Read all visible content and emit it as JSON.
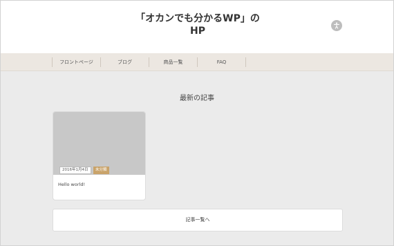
{
  "header": {
    "title_line1": "「オカンでも分かるWP」の",
    "title_line2": "HP",
    "toggle_icon": "accessibility-icon"
  },
  "nav": {
    "items": [
      "フロントページ",
      "ブログ",
      "商品一覧",
      "FAQ"
    ]
  },
  "main": {
    "section_title": "最新の記事",
    "card": {
      "date": "2016年1月4日",
      "category": "未分類",
      "title": "Hello world!"
    },
    "more_button": "記事一覧へ"
  },
  "colors": {
    "page_bg": "#ebebeb",
    "nav_bg": "#ece7e1",
    "category_badge": "#c9a36a",
    "thumbnail": "#c8c8c8"
  }
}
